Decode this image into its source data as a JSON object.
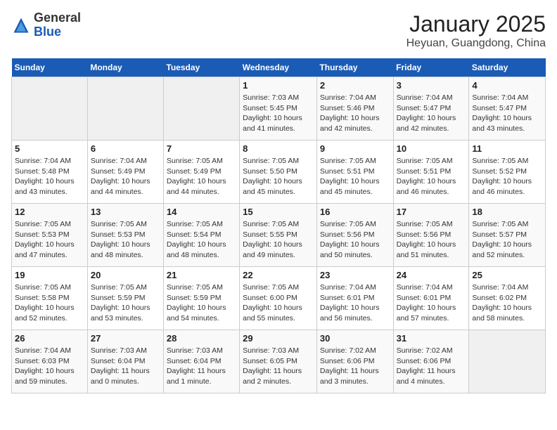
{
  "header": {
    "logo_general": "General",
    "logo_blue": "Blue",
    "month_title": "January 2025",
    "location": "Heyuan, Guangdong, China"
  },
  "days_of_week": [
    "Sunday",
    "Monday",
    "Tuesday",
    "Wednesday",
    "Thursday",
    "Friday",
    "Saturday"
  ],
  "weeks": [
    [
      {
        "day": "",
        "info": ""
      },
      {
        "day": "",
        "info": ""
      },
      {
        "day": "",
        "info": ""
      },
      {
        "day": "1",
        "info": "Sunrise: 7:03 AM\nSunset: 5:45 PM\nDaylight: 10 hours\nand 41 minutes."
      },
      {
        "day": "2",
        "info": "Sunrise: 7:04 AM\nSunset: 5:46 PM\nDaylight: 10 hours\nand 42 minutes."
      },
      {
        "day": "3",
        "info": "Sunrise: 7:04 AM\nSunset: 5:47 PM\nDaylight: 10 hours\nand 42 minutes."
      },
      {
        "day": "4",
        "info": "Sunrise: 7:04 AM\nSunset: 5:47 PM\nDaylight: 10 hours\nand 43 minutes."
      }
    ],
    [
      {
        "day": "5",
        "info": "Sunrise: 7:04 AM\nSunset: 5:48 PM\nDaylight: 10 hours\nand 43 minutes."
      },
      {
        "day": "6",
        "info": "Sunrise: 7:04 AM\nSunset: 5:49 PM\nDaylight: 10 hours\nand 44 minutes."
      },
      {
        "day": "7",
        "info": "Sunrise: 7:05 AM\nSunset: 5:49 PM\nDaylight: 10 hours\nand 44 minutes."
      },
      {
        "day": "8",
        "info": "Sunrise: 7:05 AM\nSunset: 5:50 PM\nDaylight: 10 hours\nand 45 minutes."
      },
      {
        "day": "9",
        "info": "Sunrise: 7:05 AM\nSunset: 5:51 PM\nDaylight: 10 hours\nand 45 minutes."
      },
      {
        "day": "10",
        "info": "Sunrise: 7:05 AM\nSunset: 5:51 PM\nDaylight: 10 hours\nand 46 minutes."
      },
      {
        "day": "11",
        "info": "Sunrise: 7:05 AM\nSunset: 5:52 PM\nDaylight: 10 hours\nand 46 minutes."
      }
    ],
    [
      {
        "day": "12",
        "info": "Sunrise: 7:05 AM\nSunset: 5:53 PM\nDaylight: 10 hours\nand 47 minutes."
      },
      {
        "day": "13",
        "info": "Sunrise: 7:05 AM\nSunset: 5:53 PM\nDaylight: 10 hours\nand 48 minutes."
      },
      {
        "day": "14",
        "info": "Sunrise: 7:05 AM\nSunset: 5:54 PM\nDaylight: 10 hours\nand 48 minutes."
      },
      {
        "day": "15",
        "info": "Sunrise: 7:05 AM\nSunset: 5:55 PM\nDaylight: 10 hours\nand 49 minutes."
      },
      {
        "day": "16",
        "info": "Sunrise: 7:05 AM\nSunset: 5:56 PM\nDaylight: 10 hours\nand 50 minutes."
      },
      {
        "day": "17",
        "info": "Sunrise: 7:05 AM\nSunset: 5:56 PM\nDaylight: 10 hours\nand 51 minutes."
      },
      {
        "day": "18",
        "info": "Sunrise: 7:05 AM\nSunset: 5:57 PM\nDaylight: 10 hours\nand 52 minutes."
      }
    ],
    [
      {
        "day": "19",
        "info": "Sunrise: 7:05 AM\nSunset: 5:58 PM\nDaylight: 10 hours\nand 52 minutes."
      },
      {
        "day": "20",
        "info": "Sunrise: 7:05 AM\nSunset: 5:59 PM\nDaylight: 10 hours\nand 53 minutes."
      },
      {
        "day": "21",
        "info": "Sunrise: 7:05 AM\nSunset: 5:59 PM\nDaylight: 10 hours\nand 54 minutes."
      },
      {
        "day": "22",
        "info": "Sunrise: 7:05 AM\nSunset: 6:00 PM\nDaylight: 10 hours\nand 55 minutes."
      },
      {
        "day": "23",
        "info": "Sunrise: 7:04 AM\nSunset: 6:01 PM\nDaylight: 10 hours\nand 56 minutes."
      },
      {
        "day": "24",
        "info": "Sunrise: 7:04 AM\nSunset: 6:01 PM\nDaylight: 10 hours\nand 57 minutes."
      },
      {
        "day": "25",
        "info": "Sunrise: 7:04 AM\nSunset: 6:02 PM\nDaylight: 10 hours\nand 58 minutes."
      }
    ],
    [
      {
        "day": "26",
        "info": "Sunrise: 7:04 AM\nSunset: 6:03 PM\nDaylight: 10 hours\nand 59 minutes."
      },
      {
        "day": "27",
        "info": "Sunrise: 7:03 AM\nSunset: 6:04 PM\nDaylight: 11 hours\nand 0 minutes."
      },
      {
        "day": "28",
        "info": "Sunrise: 7:03 AM\nSunset: 6:04 PM\nDaylight: 11 hours\nand 1 minute."
      },
      {
        "day": "29",
        "info": "Sunrise: 7:03 AM\nSunset: 6:05 PM\nDaylight: 11 hours\nand 2 minutes."
      },
      {
        "day": "30",
        "info": "Sunrise: 7:02 AM\nSunset: 6:06 PM\nDaylight: 11 hours\nand 3 minutes."
      },
      {
        "day": "31",
        "info": "Sunrise: 7:02 AM\nSunset: 6:06 PM\nDaylight: 11 hours\nand 4 minutes."
      },
      {
        "day": "",
        "info": ""
      }
    ]
  ]
}
